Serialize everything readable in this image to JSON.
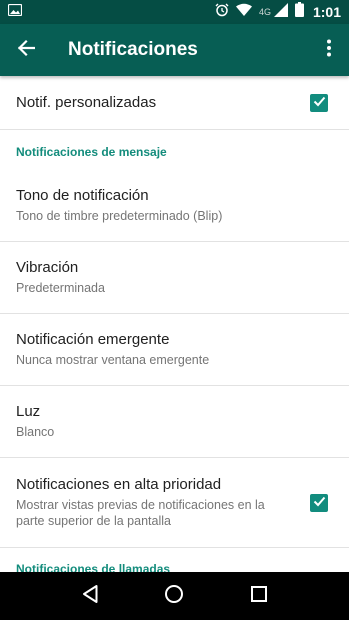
{
  "status_bar": {
    "time": "1:01",
    "network": "4G",
    "icons": [
      "image-icon",
      "alarm-icon",
      "wifi-icon",
      "signal-icon",
      "battery-icon"
    ]
  },
  "app_bar": {
    "title": "Notificaciones",
    "back_icon": "arrow-back-icon",
    "menu_icon": "more-vert-icon"
  },
  "custom_notifications": {
    "label": "Notif. personalizadas",
    "checked": true
  },
  "message_section": {
    "header": "Notificaciones de mensaje",
    "items": [
      {
        "title": "Tono de notificación",
        "subtitle": "Tono de timbre predeterminado (Blip)"
      },
      {
        "title": "Vibración",
        "subtitle": "Predeterminada"
      },
      {
        "title": "Notificación emergente",
        "subtitle": "Nunca mostrar ventana emergente"
      },
      {
        "title": "Luz",
        "subtitle": "Blanco"
      }
    ]
  },
  "priority": {
    "title": "Notificaciones en alta prioridad",
    "subtitle": "Mostrar vistas previas de notificaciones en la parte superior de la pantalla",
    "checked": true
  },
  "calls_section": {
    "header": "Notificaciones de llamadas"
  },
  "nav_bar": {
    "buttons": [
      "back-triangle-icon",
      "home-circle-icon",
      "recents-square-icon"
    ]
  },
  "colors": {
    "status_bar": "#054d44",
    "app_bar": "#075e54",
    "accent": "#128c7e",
    "section_header": "#138c7c"
  }
}
